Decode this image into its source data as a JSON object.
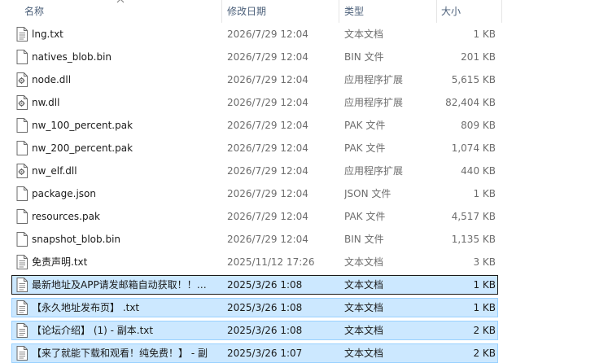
{
  "columns": {
    "name": "名称",
    "date": "修改日期",
    "type": "类型",
    "size": "大小"
  },
  "files": [
    {
      "name": "lng.txt",
      "date": "2026/7/29 12:04",
      "type": "文本文档",
      "size": "1 KB",
      "icon": "text-file-icon",
      "selected": false
    },
    {
      "name": "natives_blob.bin",
      "date": "2026/7/29 12:04",
      "type": "BIN 文件",
      "size": "201 KB",
      "icon": "generic-file-icon",
      "selected": false
    },
    {
      "name": "node.dll",
      "date": "2026/7/29 12:04",
      "type": "应用程序扩展",
      "size": "5,615 KB",
      "icon": "dll-file-icon",
      "selected": false
    },
    {
      "name": "nw.dll",
      "date": "2026/7/29 12:04",
      "type": "应用程序扩展",
      "size": "82,404 KB",
      "icon": "dll-file-icon",
      "selected": false
    },
    {
      "name": "nw_100_percent.pak",
      "date": "2026/7/29 12:04",
      "type": "PAK 文件",
      "size": "809 KB",
      "icon": "generic-file-icon",
      "selected": false
    },
    {
      "name": "nw_200_percent.pak",
      "date": "2026/7/29 12:04",
      "type": "PAK 文件",
      "size": "1,074 KB",
      "icon": "generic-file-icon",
      "selected": false
    },
    {
      "name": "nw_elf.dll",
      "date": "2026/7/29 12:04",
      "type": "应用程序扩展",
      "size": "440 KB",
      "icon": "dll-file-icon",
      "selected": false
    },
    {
      "name": "package.json",
      "date": "2026/7/29 12:04",
      "type": "JSON 文件",
      "size": "1 KB",
      "icon": "generic-file-icon",
      "selected": false
    },
    {
      "name": "resources.pak",
      "date": "2026/7/29 12:04",
      "type": "PAK 文件",
      "size": "4,517 KB",
      "icon": "generic-file-icon",
      "selected": false
    },
    {
      "name": "snapshot_blob.bin",
      "date": "2026/7/29 12:04",
      "type": "BIN 文件",
      "size": "1,135 KB",
      "icon": "generic-file-icon",
      "selected": false
    },
    {
      "name": "免责声明.txt",
      "date": "2025/11/12 17:26",
      "type": "文本文档",
      "size": "3 KB",
      "icon": "text-file-icon",
      "selected": false
    },
    {
      "name": "最新地址及APP请发邮箱自动获取！！！...",
      "date": "2025/3/26 1:08",
      "type": "文本文档",
      "size": "1 KB",
      "icon": "text-file-icon",
      "selected": true,
      "focused": true
    },
    {
      "name": "【永久地址发布页】 .txt",
      "date": "2025/3/26 1:08",
      "type": "文本文档",
      "size": "1 KB",
      "icon": "text-file-icon",
      "selected": true
    },
    {
      "name": "【论坛介绍】 (1) - 副本.txt",
      "date": "2025/3/26 1:08",
      "type": "文本文档",
      "size": "2 KB",
      "icon": "text-file-icon",
      "selected": true
    },
    {
      "name": "【来了就能下载和观看！纯免费！】 - 副",
      "date": "2025/3/26 1:07",
      "type": "文本文档",
      "size": "2 KB",
      "icon": "text-file-icon",
      "selected": true
    }
  ]
}
